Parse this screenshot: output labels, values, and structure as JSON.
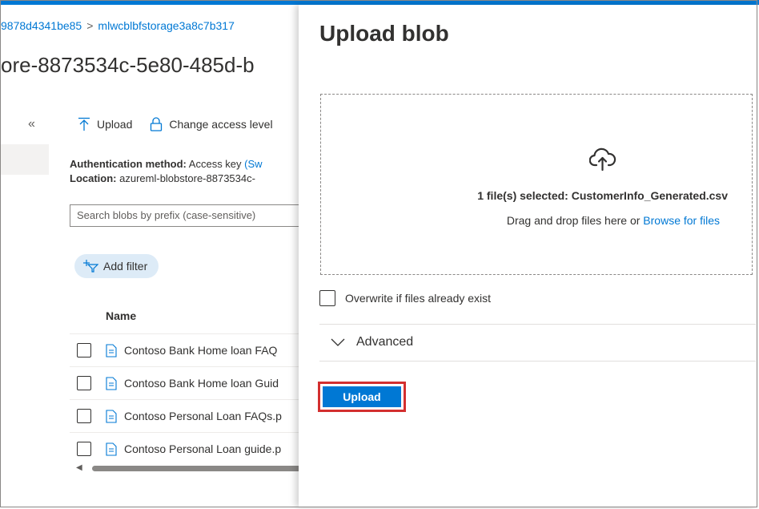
{
  "breadcrumb": {
    "items": [
      "9878d4341be85",
      "mlwcblbfstorage3a8c7b317"
    ],
    "separator": ">"
  },
  "page": {
    "title": "ore-8873534c-5e80-485d-b"
  },
  "sidebar": {
    "collapse_glyph": "«"
  },
  "toolbar": {
    "upload_label": "Upload",
    "change_access_label": "Change access level"
  },
  "info": {
    "auth_label": "Authentication method:",
    "auth_value": "Access key",
    "auth_link": "(Sw",
    "location_label": "Location:",
    "location_value": "azureml-blobstore-8873534c-"
  },
  "search": {
    "placeholder": "Search blobs by prefix (case-sensitive)"
  },
  "filter": {
    "label": "Add filter"
  },
  "table": {
    "column_name": "Name",
    "rows": [
      "Contoso Bank Home loan FAQ",
      "Contoso Bank Home loan Guid",
      "Contoso Personal Loan FAQs.p",
      "Contoso Personal Loan guide.p"
    ]
  },
  "panel": {
    "title": "Upload blob",
    "selected_text": "1 file(s) selected: CustomerInfo_Generated.csv",
    "drag_text": "Drag and drop files here",
    "or_text": "or",
    "browse_link": "Browse for files",
    "overwrite_label": "Overwrite if files already exist",
    "advanced_label": "Advanced",
    "upload_button": "Upload"
  },
  "colors": {
    "accent": "#0078d4",
    "highlight": "#d32f2f",
    "filter_bg": "#ddebf7"
  },
  "icons": [
    "upload-arrow-icon",
    "lock-icon",
    "filter-add-icon",
    "file-icon",
    "cloud-upload-icon",
    "chevron-down-icon"
  ]
}
